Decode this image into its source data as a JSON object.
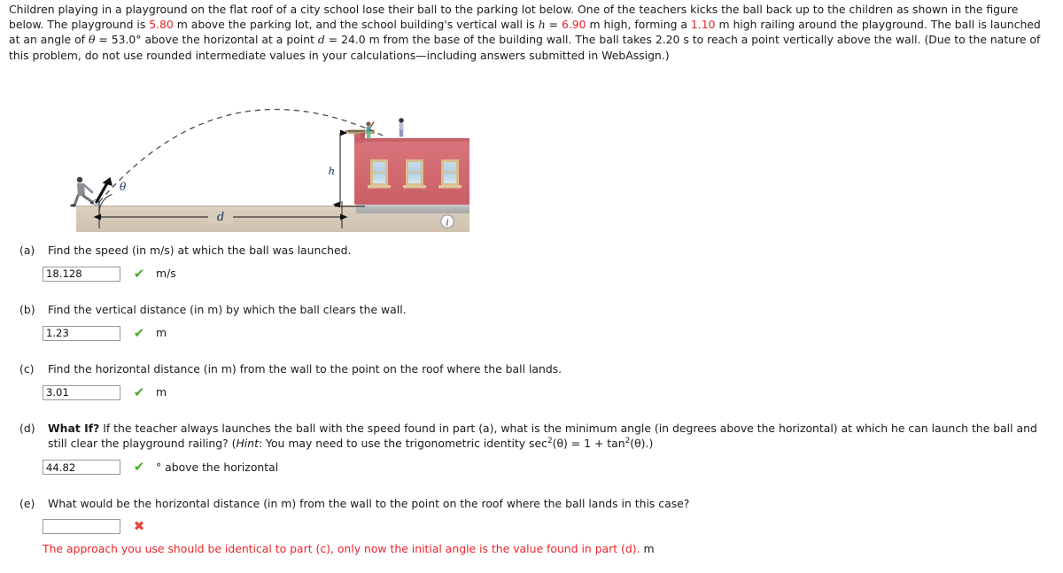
{
  "problem": {
    "p1_a": "Children playing in a playground on the flat roof of a city school lose their ball to the parking lot below. One of the teachers kicks the ball back up to the children as shown in the figure below. The playground is ",
    "val_playground_height": "5.80",
    "p1_b": " m above the parking lot, and the school building's vertical wall is ",
    "var_h": "h",
    "eq1": " = ",
    "val_h": "6.90",
    "p1_c": " m high, forming a ",
    "val_railing": "1.10",
    "p1_d": " m high railing around the playground. The ball is launched at an angle of ",
    "var_theta": "θ",
    "eq2": " = ",
    "val_theta": "53.0°",
    "p1_e": " above the horizontal at a point ",
    "var_d": "d",
    "eq3": " = ",
    "val_d": "24.0",
    "p1_f": " m from the base of the building wall. The ball takes 2.20 s to reach a point vertically above the wall. (Due to the nature of this problem, do not use rounded intermediate values in your calculations—including answers submitted in WebAssign.)"
  },
  "figure": {
    "label_theta": "θ",
    "label_h": "h",
    "label_d": "d",
    "info_icon_label": "i",
    "colors": {
      "building_wall": "#d9737a",
      "building_wall_dark": "#c9616a",
      "window_frame": "#d8be8e",
      "window_glass": "#bcd6e8",
      "ground": "#d9cdbe",
      "ground_top": "#ded3c5",
      "sidewalk": "#b9b9b9",
      "trajectory": "#4a4a4a"
    }
  },
  "questions": [
    {
      "label": "(a)",
      "text": "Find the speed (in m/s) at which the ball was launched.",
      "value": "18.128",
      "placeholder": "",
      "status": "correct",
      "status_glyph": "✔",
      "unit": "m/s"
    },
    {
      "label": "(b)",
      "text": "Find the vertical distance (in m) by which the ball clears the wall.",
      "value": "1.23",
      "placeholder": "",
      "status": "correct",
      "status_glyph": "✔",
      "unit": "m"
    },
    {
      "label": "(c)",
      "text": "Find the horizontal distance (in m) from the wall to the point on the roof where the ball lands.",
      "value": "3.01",
      "placeholder": "",
      "status": "correct",
      "status_glyph": "✔",
      "unit": "m"
    }
  ],
  "question_d": {
    "label": "(d)",
    "whatif": "What If?",
    "text_1": " If the teacher always launches the ball with the speed found in part (a), what is the minimum angle (in degrees above the horizontal) at which he can launch the ball and still clear the playground railing? (",
    "hint_label": "Hint",
    "text_2": ": You may need to use the trigonometric identity sec",
    "sup_2a": "2",
    "text_3": "(θ) = 1 + tan",
    "sup_2b": "2",
    "text_4": "(θ).)",
    "value": "44.82",
    "placeholder": "",
    "status": "correct",
    "status_glyph": "✔",
    "unit": "° above the horizontal"
  },
  "question_e": {
    "label": "(e)",
    "text": "What would be the horizontal distance (in m) from the wall to the point on the roof where the ball lands in this case?",
    "value": "",
    "placeholder": "",
    "status": "incorrect",
    "status_glyph": "✖",
    "feedback": "The approach you use should be identical to part (c), only now the initial angle is the value found in part (d).",
    "feedback_unit": "m"
  },
  "colors": {
    "red": "#e8232a",
    "green_check": "#4cab2e",
    "red_cross": "#e8413c",
    "input_border": "#9a9a9a"
  }
}
